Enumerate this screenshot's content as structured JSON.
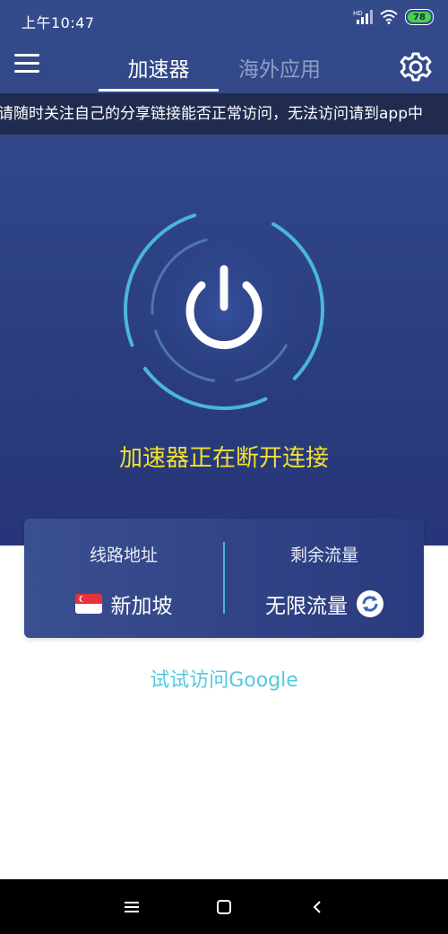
{
  "status_bar": {
    "time": "上午10:47",
    "battery": "78",
    "icons": [
      "hd-signal-icon",
      "wifi-icon",
      "battery-icon"
    ]
  },
  "header": {
    "menu_icon": "menu-icon",
    "tabs": [
      {
        "label": "加速器",
        "active": true
      },
      {
        "label": "海外应用",
        "active": false
      }
    ],
    "settings_icon": "gear-icon"
  },
  "notice": {
    "text": "请随时关注自己的分享链接能否正常访问，无法访问请到app中"
  },
  "connection": {
    "power_icon": "power-icon",
    "status": "加速器正在断开连接"
  },
  "info_card": {
    "route_label": "线路地址",
    "route_value": "新加坡",
    "route_flag": "singapore-flag-icon",
    "traffic_label": "剩余流量",
    "traffic_value": "无限流量",
    "refresh_icon": "refresh-icon"
  },
  "google_link": "试试访问Google",
  "colors": {
    "header_bg": "#2f4588",
    "status_text": "#f2e12e",
    "link": "#55c8e0",
    "ring": "#4fc3e6"
  },
  "nav": [
    "recent-apps-icon",
    "home-icon",
    "back-icon"
  ]
}
